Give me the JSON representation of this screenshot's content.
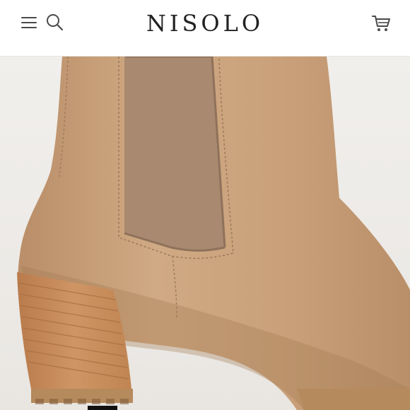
{
  "header": {
    "brand": "NISOLO",
    "menu_icon": "hamburger-menu-icon",
    "search_icon": "search-icon",
    "cart_icon": "cart-icon"
  },
  "product": {
    "image_subject": "boot-image",
    "colors": {
      "background": "#efece9",
      "leather": "#c79f78",
      "elastic_panel": "#a88a72",
      "heel_wood": "#c68a5a",
      "sole": "#a47c52"
    }
  },
  "gallery": {
    "active_indicator": "active"
  }
}
